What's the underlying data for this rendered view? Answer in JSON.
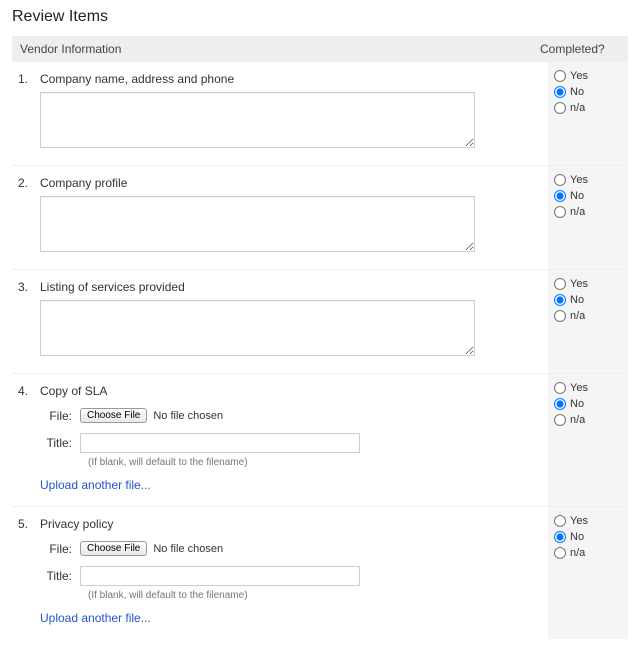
{
  "page_title": "Review Items",
  "section_header": {
    "main": "Vendor Information",
    "completed": "Completed?"
  },
  "radio_options": {
    "yes": "Yes",
    "no": "No",
    "na": "n/a"
  },
  "file_widget": {
    "file_label": "File:",
    "choose_label": "Choose File",
    "no_file": "No file chosen",
    "title_label": "Title:",
    "hint": "(If blank, will default to the filename)",
    "upload_another": "Upload another file..."
  },
  "items": [
    {
      "num": "1.",
      "label": "Company name, address and phone",
      "type": "textarea",
      "value": "",
      "selected": "no"
    },
    {
      "num": "2.",
      "label": "Company profile",
      "type": "textarea",
      "value": "",
      "selected": "no"
    },
    {
      "num": "3.",
      "label": "Listing of services provided",
      "type": "textarea",
      "value": "",
      "selected": "no"
    },
    {
      "num": "4.",
      "label": "Copy of SLA",
      "type": "file",
      "title_value": "",
      "selected": "no"
    },
    {
      "num": "5.",
      "label": "Privacy policy",
      "type": "file",
      "title_value": "",
      "selected": "no"
    }
  ]
}
